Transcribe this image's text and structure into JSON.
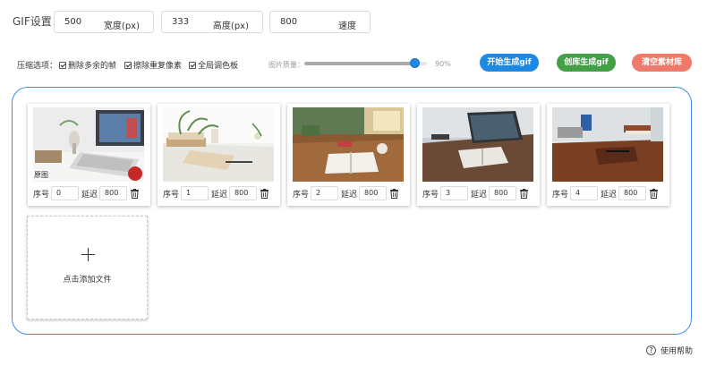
{
  "settings": {
    "label": "GIF设置：",
    "width": {
      "value": "500",
      "unit": "宽度(px)"
    },
    "height": {
      "value": "333",
      "unit": "高度(px)"
    },
    "speed": {
      "value": "800",
      "unit": "速度"
    }
  },
  "compression": {
    "label": "压缩选项：",
    "options": [
      {
        "label": "删除多余的帧",
        "checked": true
      },
      {
        "label": "擦除重复像素",
        "checked": true
      },
      {
        "label": "全局调色板",
        "checked": true
      }
    ],
    "quality_label": "图片质量：",
    "quality_value": "90%",
    "quality_fraction": 0.9
  },
  "actions": {
    "start": "开始生成gif",
    "create": "创库生成gif",
    "clear": "清空素材库"
  },
  "frames": {
    "index_label": "序号",
    "delay_label": "延迟",
    "original_label": "原图",
    "items": [
      {
        "index": "0",
        "delay": "800"
      },
      {
        "index": "1",
        "delay": "800"
      },
      {
        "index": "2",
        "delay": "800"
      },
      {
        "index": "3",
        "delay": "800"
      },
      {
        "index": "4",
        "delay": "800"
      }
    ]
  },
  "add_file": "点击添加文件",
  "help": "使用帮助",
  "colors": {
    "accent_blue": "#1e88e5",
    "accent_green": "#43a047",
    "accent_red": "#ef7a6b",
    "panel_border": "#3f8de6"
  }
}
